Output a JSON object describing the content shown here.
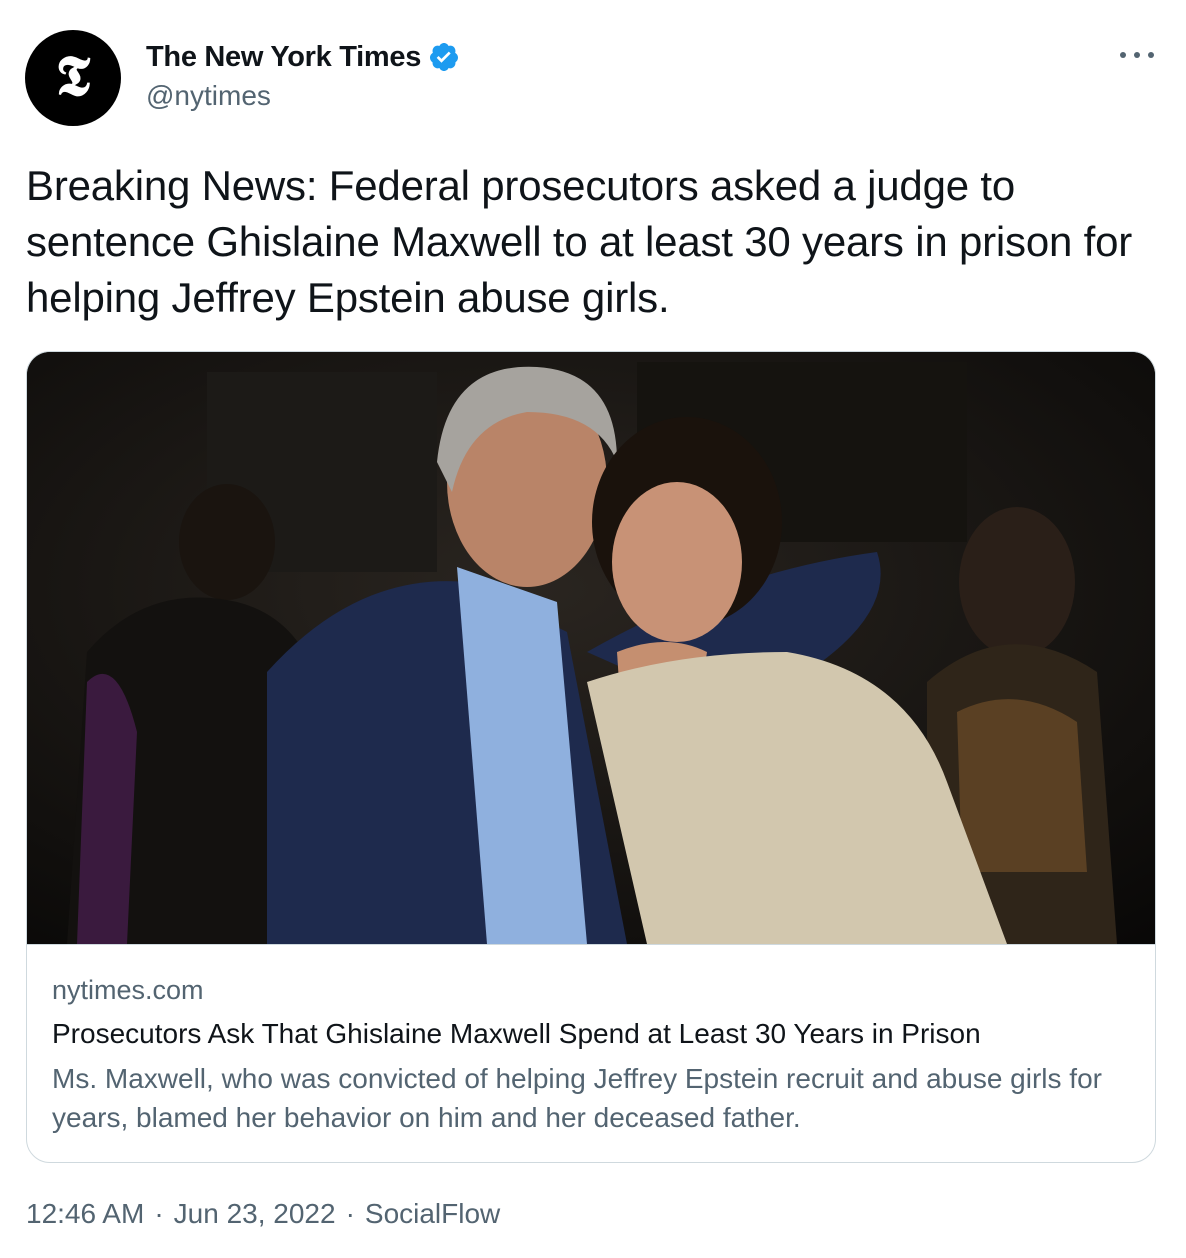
{
  "author": {
    "display_name": "The New York Times",
    "handle": "@nytimes",
    "avatar_glyph": "𝕿",
    "verified": true
  },
  "tweet": {
    "text": "Breaking News: Federal prosecutors asked a judge to sentence Ghislaine Maxwell to at least 30 years in prison for helping Jeffrey Epstein abuse girls."
  },
  "card": {
    "domain": "nytimes.com",
    "title": "Prosecutors Ask That Ghislaine Maxwell Spend at Least 30 Years in Prison",
    "description": "Ms. Maxwell, who was convicted of helping Jeffrey Epstein recruit and abuse girls for years, blamed her behavior on him and her deceased father."
  },
  "meta": {
    "time": "12:46 AM",
    "separator": "·",
    "date": "Jun 23, 2022",
    "source": "SocialFlow"
  },
  "icons": {
    "verified": "verified-badge-icon",
    "more": "more-options-icon"
  },
  "colors": {
    "primary_text": "#0f1419",
    "secondary_text": "#536471",
    "border": "#cfd9de",
    "verified_blue": "#1d9bf0"
  }
}
